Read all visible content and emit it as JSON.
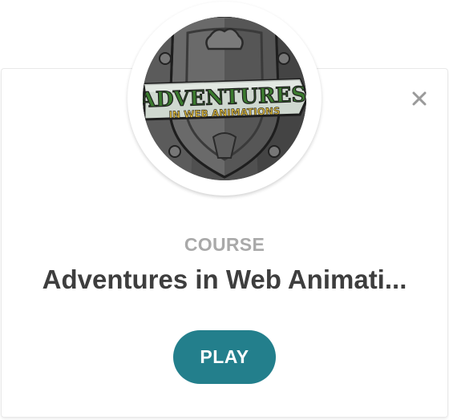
{
  "badge": {
    "art_line1": "ADVENTURES",
    "art_line2": "IN WEB ANIMATIONS"
  },
  "card": {
    "eyebrow": "COURSE",
    "title": "Adventures in Web Animati...",
    "play_label": "PLAY",
    "close_icon": "close-icon"
  },
  "colors": {
    "accent": "#237f8c",
    "title": "#3e3e3e",
    "eyebrow": "#a9a9a9",
    "close": "#9a9a9a"
  }
}
